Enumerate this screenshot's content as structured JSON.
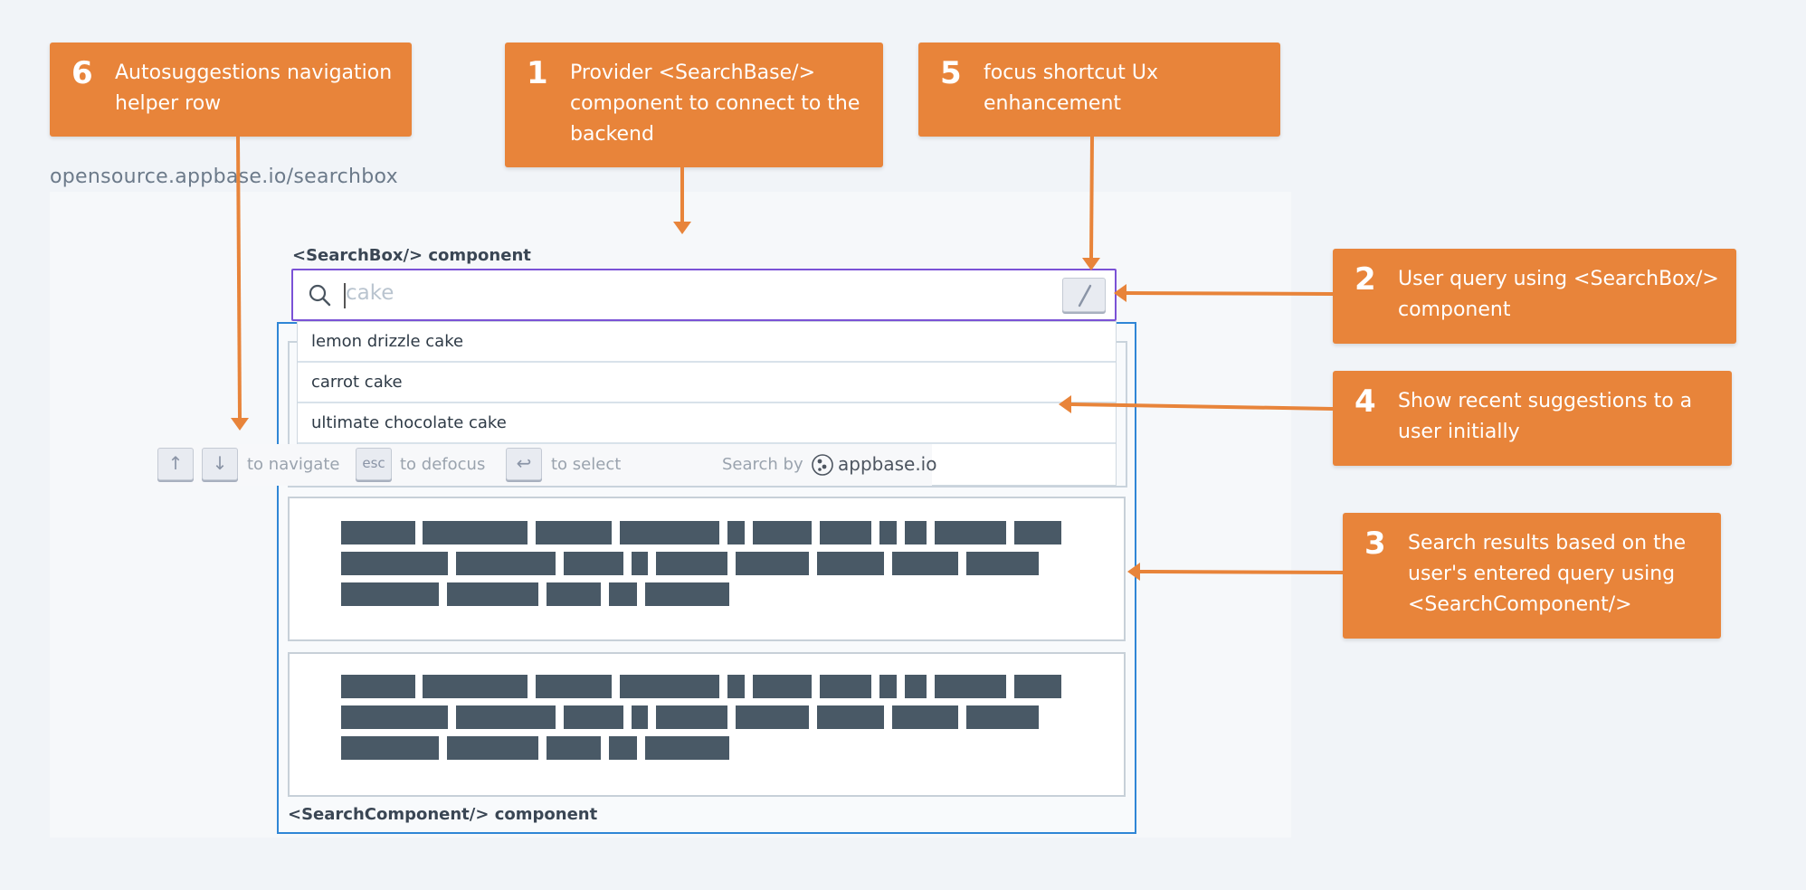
{
  "url": "opensource.appbase.io/searchbox",
  "labels": {
    "searchbox": "<SearchBox/> component",
    "searchcomponent": "<SearchComponent/> component"
  },
  "search_input": {
    "placeholder": "cake",
    "shortcut_key": "/"
  },
  "suggestions": [
    "lemon drizzle cake",
    "carrot cake",
    "ultimate chocolate cake"
  ],
  "helper_row": {
    "up_key": "↑",
    "down_key": "↓",
    "navigate_text": "to navigate",
    "esc_key": "esc",
    "defocus_text": "to defocus",
    "enter_key": "↩",
    "select_text": "to select",
    "search_by_text": "Search by",
    "brand": "appbase.io"
  },
  "callouts": [
    {
      "number": "6",
      "text": "Autosuggestions navigation helper row"
    },
    {
      "number": "1",
      "text": "Provider <SearchBase/> component to connect to the backend"
    },
    {
      "number": "5",
      "text": "focus shortcut Ux enhancement"
    },
    {
      "number": "2",
      "text": "User query using <SearchBox/> component"
    },
    {
      "number": "4",
      "text": "Show recent suggestions to a user initially"
    },
    {
      "number": "3",
      "text": "Search results based on the user's entered query using <SearchComponent/>"
    }
  ],
  "colors": {
    "callout": "#e8843a",
    "searchbox_border": "#7b52d6",
    "searchcomponent_border": "#2f86d6",
    "result_bar": "#495966"
  }
}
